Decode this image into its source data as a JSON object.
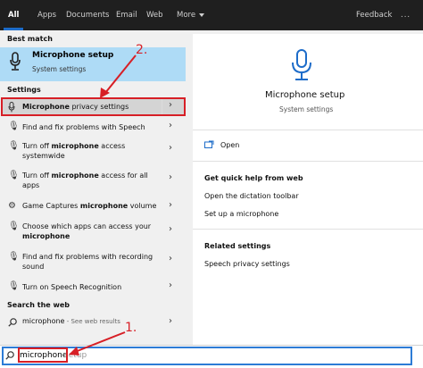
{
  "tabs": [
    {
      "label": "All",
      "active": true
    },
    {
      "label": "Apps"
    },
    {
      "label": "Documents"
    },
    {
      "label": "Email"
    },
    {
      "label": "Web"
    },
    {
      "label": "More"
    }
  ],
  "feedback_label": "Feedback",
  "more_label": "...",
  "best_match": {
    "heading": "Best match",
    "title": "Microphone setup",
    "subtitle": "System settings"
  },
  "settings_heading": "Settings",
  "settings_items": [
    {
      "icon": "microphone-icon",
      "text_bold": "Microphone",
      "text": " privacy settings"
    },
    {
      "icon": "microphone-icon",
      "text": "Find and fix problems with Speech"
    },
    {
      "icon": "microphone-icon",
      "text_pre": "Turn off ",
      "text_bold": "microphone",
      "text": " access systemwide"
    },
    {
      "icon": "microphone-icon",
      "text_pre": "Turn off ",
      "text_bold": "microphone",
      "text": " access for all apps"
    },
    {
      "icon": "gear-icon",
      "text_pre": "Game Captures ",
      "text_bold": "microphone",
      "text": " volume"
    },
    {
      "icon": "microphone-icon",
      "text_pre": "Choose which apps can access your ",
      "text_bold": "microphone",
      "text": ""
    },
    {
      "icon": "microphone-icon",
      "text": "Find and fix problems with recording sound"
    },
    {
      "icon": "microphone-icon",
      "text": "Turn on Speech Recognition"
    }
  ],
  "search_web": {
    "heading": "Search the web",
    "query": "microphone",
    "suffix": " - See web results"
  },
  "detail": {
    "title": "Microphone setup",
    "subtitle": "System settings",
    "open_label": "Open",
    "help_heading": "Get quick help from web",
    "help_links": [
      "Open the dictation toolbar",
      "Set up a microphone"
    ],
    "related_heading": "Related settings",
    "related_links": [
      "Speech privacy settings"
    ]
  },
  "search": {
    "value": "microphone",
    "hint": "setup"
  },
  "annotations": {
    "step1": "1.",
    "step2": "2."
  },
  "colors": {
    "accent": "#1d6cc9",
    "highlight_border": "#d71f26",
    "best_bg": "#aedbf6"
  }
}
